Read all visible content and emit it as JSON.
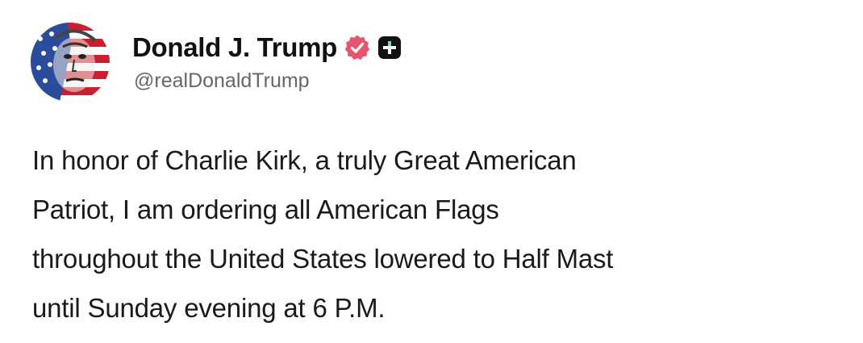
{
  "post": {
    "author": {
      "display_name": "Donald J. Trump",
      "handle": "@realDonaldTrump",
      "avatar": "flag-portrait-avatar",
      "verified_icon": "verified-check-icon",
      "plus_icon": "plus-square-icon"
    },
    "body_lines": [
      "In honor of Charlie Kirk, a truly Great American",
      "Patriot, I am ordering all American Flags",
      "throughout the United States lowered to Half Mast",
      "until Sunday evening at 6 P.M."
    ]
  },
  "colors": {
    "verified_badge": "#e5566e",
    "plus_badge": "#111111",
    "text": "#1a1a1a",
    "handle": "#666666",
    "background": "#ffffff"
  }
}
